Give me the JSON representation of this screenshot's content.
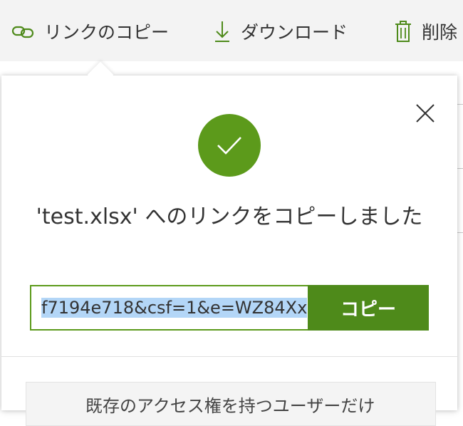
{
  "toolbar": {
    "copy_link": "リンクのコピー",
    "download": "ダウンロード",
    "delete": "削除"
  },
  "dialog": {
    "title": "'test.xlsx' へのリンクをコピーしました",
    "link_value": "f7194e718&csf=1&e=WZ84Xx",
    "copy_button": "コピー",
    "lower_text": "既存のアクセス権を持つユーザーだけ"
  },
  "colors": {
    "accent": "#5c9a1b",
    "copy_button": "#4e8a1a",
    "selection": "#b3d6f7"
  },
  "icons": [
    "link-icon",
    "download-icon",
    "trash-icon",
    "checkmark-icon",
    "close-icon"
  ]
}
